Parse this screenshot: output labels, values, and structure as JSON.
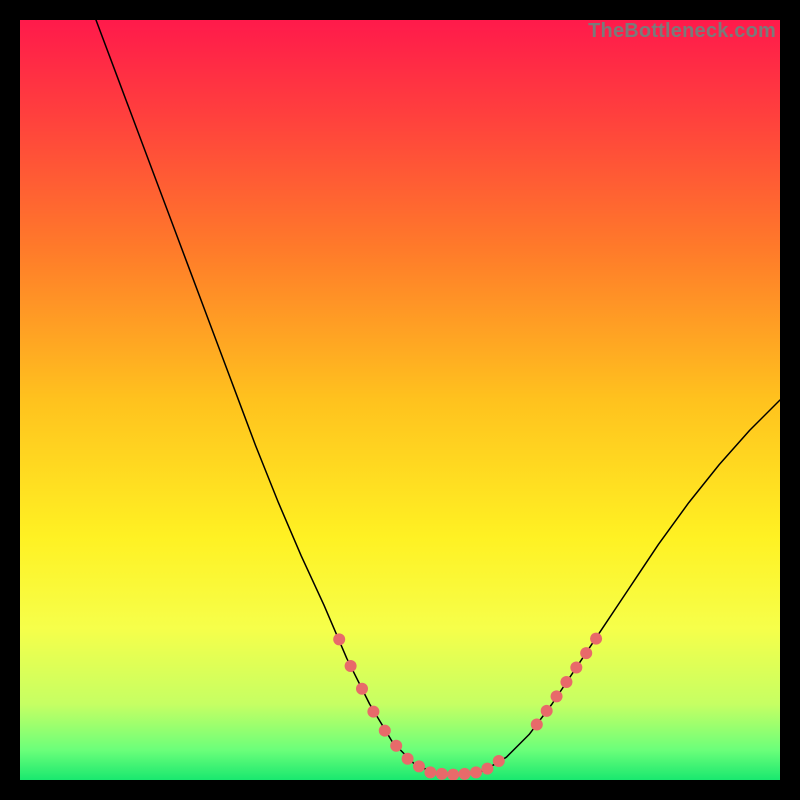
{
  "watermark": "TheBottleneck.com",
  "chart_data": {
    "type": "line",
    "title": "",
    "xlabel": "",
    "ylabel": "",
    "xlim": [
      0,
      100
    ],
    "ylim": [
      0,
      100
    ],
    "background_gradient": {
      "stops": [
        {
          "offset": 0.0,
          "color": "#ff1a4b"
        },
        {
          "offset": 0.12,
          "color": "#ff3e3e"
        },
        {
          "offset": 0.3,
          "color": "#ff7a2a"
        },
        {
          "offset": 0.5,
          "color": "#ffc21e"
        },
        {
          "offset": 0.68,
          "color": "#fff123"
        },
        {
          "offset": 0.8,
          "color": "#f6ff4a"
        },
        {
          "offset": 0.9,
          "color": "#c6ff63"
        },
        {
          "offset": 0.96,
          "color": "#6cff7a"
        },
        {
          "offset": 1.0,
          "color": "#19e86f"
        }
      ]
    },
    "series": [
      {
        "name": "bottleneck-curve",
        "color": "#000000",
        "width": 1.5,
        "points": [
          {
            "x": 10.0,
            "y": 100.0
          },
          {
            "x": 13.0,
            "y": 92.0
          },
          {
            "x": 16.0,
            "y": 84.0
          },
          {
            "x": 19.0,
            "y": 76.0
          },
          {
            "x": 22.0,
            "y": 68.0
          },
          {
            "x": 25.0,
            "y": 60.0
          },
          {
            "x": 28.0,
            "y": 52.0
          },
          {
            "x": 31.0,
            "y": 44.0
          },
          {
            "x": 34.0,
            "y": 36.5
          },
          {
            "x": 37.0,
            "y": 29.5
          },
          {
            "x": 40.0,
            "y": 23.0
          },
          {
            "x": 43.0,
            "y": 16.0
          },
          {
            "x": 46.0,
            "y": 10.0
          },
          {
            "x": 49.0,
            "y": 5.0
          },
          {
            "x": 52.0,
            "y": 2.0
          },
          {
            "x": 55.0,
            "y": 0.8
          },
          {
            "x": 58.0,
            "y": 0.7
          },
          {
            "x": 61.0,
            "y": 1.2
          },
          {
            "x": 64.0,
            "y": 3.0
          },
          {
            "x": 67.0,
            "y": 6.0
          },
          {
            "x": 70.0,
            "y": 10.0
          },
          {
            "x": 73.0,
            "y": 14.5
          },
          {
            "x": 76.0,
            "y": 19.0
          },
          {
            "x": 80.0,
            "y": 25.0
          },
          {
            "x": 84.0,
            "y": 31.0
          },
          {
            "x": 88.0,
            "y": 36.5
          },
          {
            "x": 92.0,
            "y": 41.5
          },
          {
            "x": 96.0,
            "y": 46.0
          },
          {
            "x": 100.0,
            "y": 50.0
          }
        ]
      }
    ],
    "marker_clusters": [
      {
        "name": "left-dots",
        "color": "#e86a6a",
        "radius": 6,
        "points": [
          {
            "x": 42.0,
            "y": 18.5
          },
          {
            "x": 43.5,
            "y": 15.0
          },
          {
            "x": 45.0,
            "y": 12.0
          },
          {
            "x": 46.5,
            "y": 9.0
          },
          {
            "x": 48.0,
            "y": 6.5
          },
          {
            "x": 49.5,
            "y": 4.5
          },
          {
            "x": 51.0,
            "y": 2.8
          },
          {
            "x": 52.5,
            "y": 1.8
          },
          {
            "x": 54.0,
            "y": 1.0
          },
          {
            "x": 55.5,
            "y": 0.8
          },
          {
            "x": 57.0,
            "y": 0.7
          },
          {
            "x": 58.5,
            "y": 0.8
          },
          {
            "x": 60.0,
            "y": 1.0
          },
          {
            "x": 61.5,
            "y": 1.5
          },
          {
            "x": 63.0,
            "y": 2.5
          }
        ]
      },
      {
        "name": "right-dots",
        "color": "#e86a6a",
        "radius": 6,
        "points": [
          {
            "x": 68.0,
            "y": 7.3
          },
          {
            "x": 69.3,
            "y": 9.1
          },
          {
            "x": 70.6,
            "y": 11.0
          },
          {
            "x": 71.9,
            "y": 12.9
          },
          {
            "x": 73.2,
            "y": 14.8
          },
          {
            "x": 74.5,
            "y": 16.7
          },
          {
            "x": 75.8,
            "y": 18.6
          }
        ]
      }
    ]
  }
}
